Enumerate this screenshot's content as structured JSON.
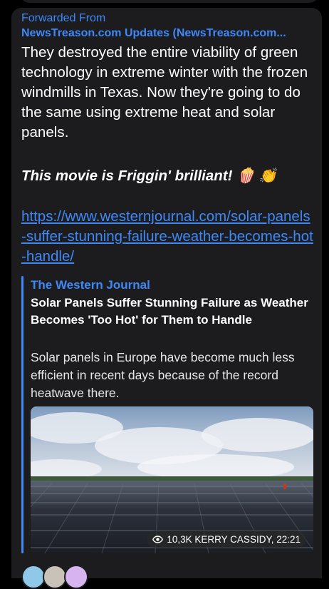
{
  "message": {
    "forwarded_label": "Forwarded From",
    "forwarded_source": "NewsTreason.com Updates (NewsTreason.com...",
    "body": "They destroyed the entire viability of green technology in extreme winter with the frozen windmills in Texas. Now they're going to do the same using extreme heat and solar panels.",
    "italic_line": "This movie is Friggin' brilliant! 🍿 👏",
    "link_url": "https://www.westernjournal.com/solar-panels-suffer-stunning-failure-weather-becomes-hot-handle/"
  },
  "preview": {
    "site_name": "The Western Journal",
    "title": "Solar Panels Suffer Stunning Failure as Weather Becomes 'Too Hot' for Them to Handle",
    "description": "Solar panels in Europe have become much less efficient in recent days because of the record heatwave there.",
    "image_icon": "solar-panel-field-photo"
  },
  "meta": {
    "views_icon": "eye-icon",
    "footer": "10,3K KERRY CASSIDY, 22:21"
  },
  "colors": {
    "background": "#000000",
    "bubble": "#1c1c1e",
    "accent": "#3e88f7",
    "text": "#ffffff"
  }
}
